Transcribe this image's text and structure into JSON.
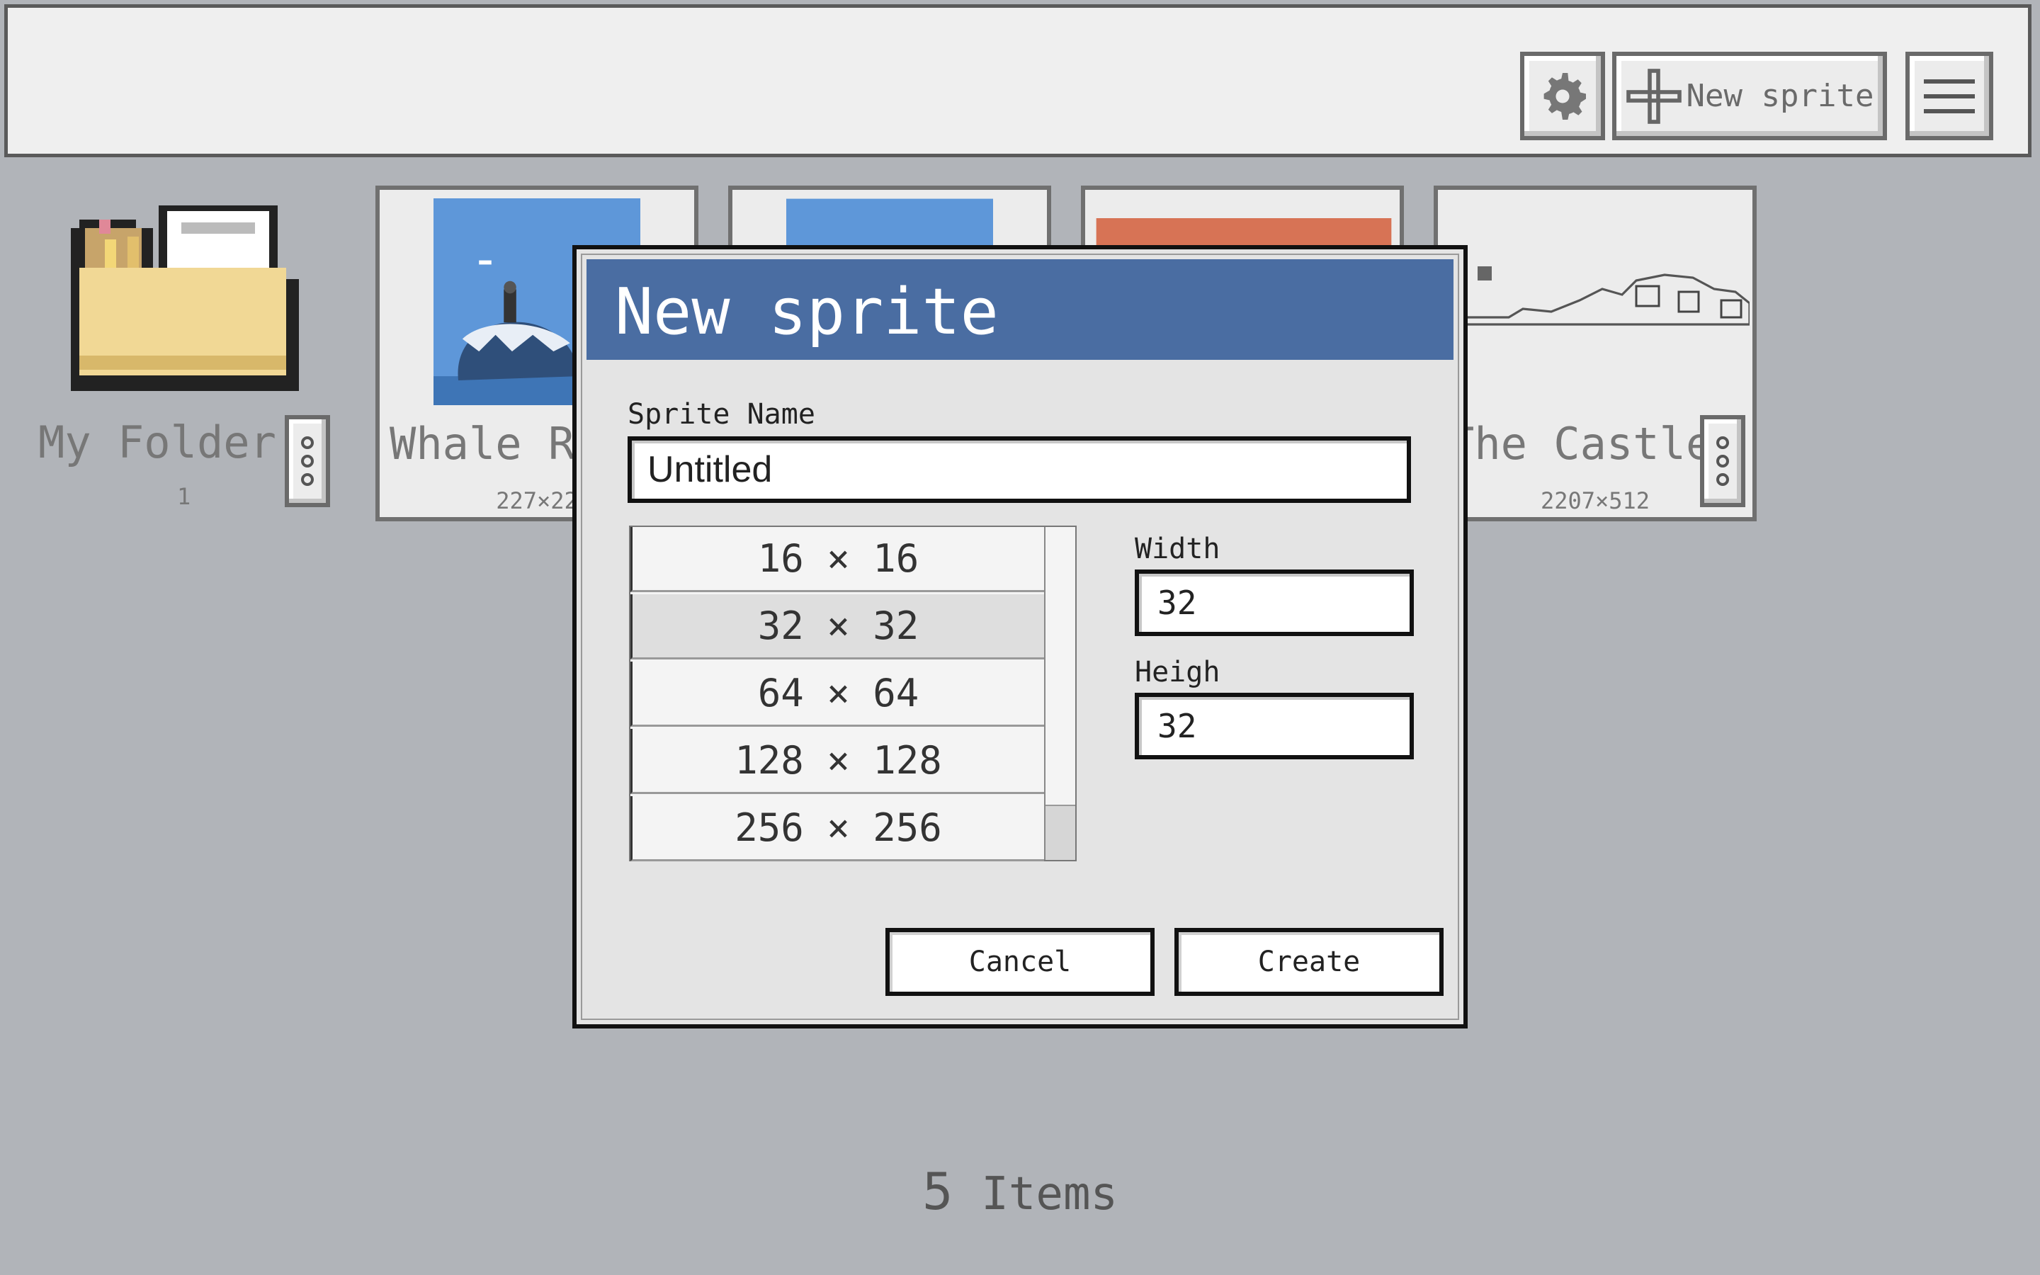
{
  "toolbar": {
    "settings_icon": "gear-icon",
    "new_sprite_label": "New sprite",
    "menu_icon": "hamburger-icon"
  },
  "gallery": {
    "folder": {
      "name": "My Folder",
      "count": "1"
    },
    "cards": [
      {
        "name": "Whale Ri",
        "size": "227×22"
      },
      {
        "name": "",
        "size": ""
      },
      {
        "name": "",
        "size": ""
      },
      {
        "name": "The Castle",
        "size": "2207×512"
      }
    ]
  },
  "dialog": {
    "title": "New sprite",
    "sprite_name_label": "Sprite Name",
    "sprite_name_value": "Untitled",
    "presets": [
      "16 × 16",
      "32 × 32",
      "64 × 64",
      "128 × 128",
      "256 × 256"
    ],
    "selected_preset": "32 × 32",
    "width_label": "Width",
    "width_value": "32",
    "height_label": "Heigh",
    "height_value": "32",
    "cancel_label": "Cancel",
    "create_label": "Create"
  },
  "footer": {
    "count": "5",
    "label": "Items"
  },
  "colors": {
    "dialog_title_bg": "#4a6da2",
    "background": "#b1b4b9",
    "toolbar_bg": "#efefef"
  }
}
